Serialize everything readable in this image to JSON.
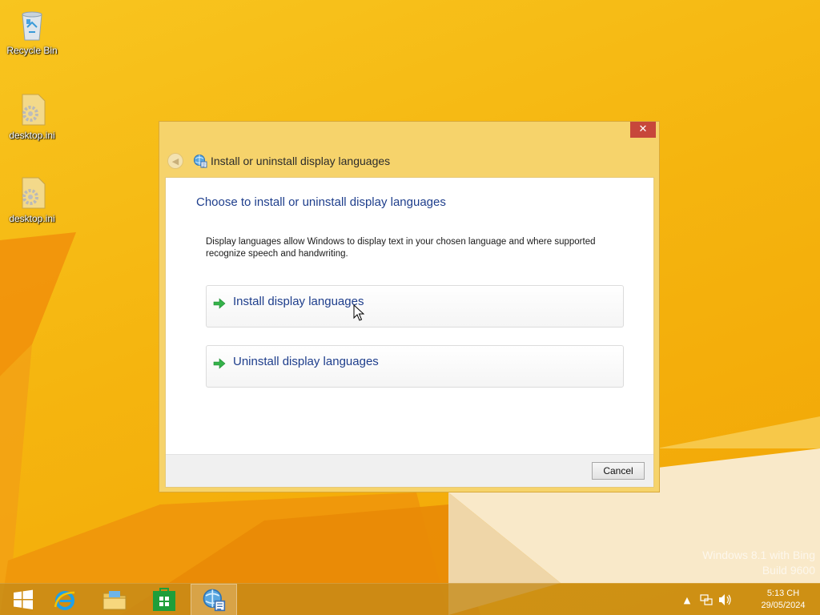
{
  "desktop": {
    "icons": [
      {
        "label": "Recycle Bin",
        "icon": "recycle-bin-icon"
      },
      {
        "label": "desktop.ini",
        "icon": "settings-file-icon"
      },
      {
        "label": "desktop.ini",
        "icon": "settings-file-icon"
      }
    ],
    "watermark": {
      "line1": "Windows 8.1 with Bing",
      "line2": "Build 9600"
    }
  },
  "window": {
    "title": "Install or uninstall display languages",
    "close_icon": "close-icon",
    "back_icon": "back-arrow-icon",
    "heading": "Choose to install or uninstall display languages",
    "description": "Display languages allow Windows to display text in your chosen language and where supported recognize speech and handwriting.",
    "options": [
      {
        "label": "Install display languages",
        "icon": "green-arrow-icon"
      },
      {
        "label": "Uninstall display languages",
        "icon": "green-arrow-icon"
      }
    ],
    "cancel_label": "Cancel"
  },
  "taskbar": {
    "items": [
      {
        "icon": "start-windows-icon"
      },
      {
        "icon": "internet-explorer-icon"
      },
      {
        "icon": "file-explorer-icon"
      },
      {
        "icon": "store-icon"
      },
      {
        "icon": "language-settings-icon",
        "active": true
      }
    ],
    "tray": {
      "icons": [
        "show-hidden-icons-icon",
        "network-icon",
        "volume-icon"
      ],
      "time": "5:13 CH",
      "date": "29/05/2024"
    }
  },
  "colors": {
    "wallpaper": "#f5b50f",
    "window_frame": "#f6d36b",
    "link_blue": "#1e3e8c",
    "close_red": "#c7473b"
  }
}
